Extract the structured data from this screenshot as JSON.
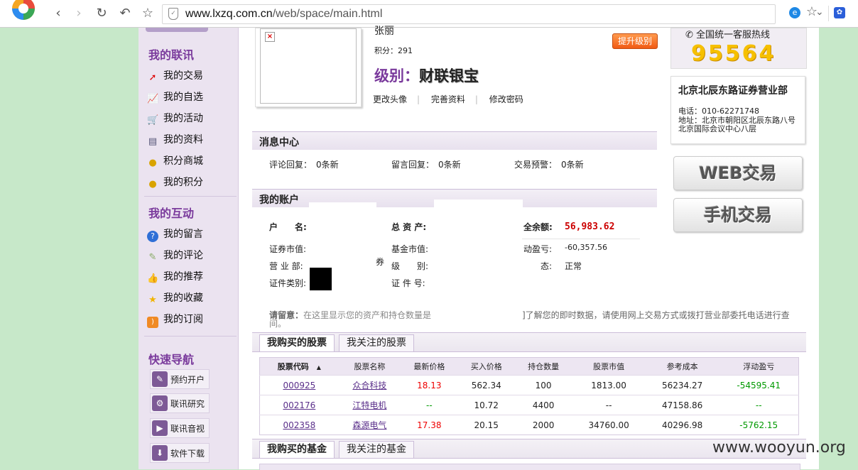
{
  "browser": {
    "url_host": "www.lxzq.com.cn",
    "url_path": "/web/space/main.html"
  },
  "sidebar": {
    "contact_title": "我的联讯",
    "contact_items": [
      {
        "label": "我的交易",
        "icon": "trend-icon"
      },
      {
        "label": "我的自选",
        "icon": "chart-icon"
      },
      {
        "label": "我的活动",
        "icon": "cart-icon"
      },
      {
        "label": "我的资料",
        "icon": "id-card-icon"
      },
      {
        "label": "积分商城",
        "icon": "coins-icon"
      },
      {
        "label": "我的积分",
        "icon": "coins-icon"
      }
    ],
    "interact_title": "我的互动",
    "interact_items": [
      {
        "label": "我的留言",
        "icon": "help-icon"
      },
      {
        "label": "我的评论",
        "icon": "edit-icon"
      },
      {
        "label": "我的推荐",
        "icon": "thumb-up-icon"
      },
      {
        "label": "我的收藏",
        "icon": "star-icon"
      },
      {
        "label": "我的订阅",
        "icon": "rss-icon"
      }
    ],
    "quick_title": "快速导航",
    "quick_items": [
      {
        "label": "预约开户",
        "icon": "edit-icon"
      },
      {
        "label": "联讯研究",
        "icon": "gear-icon"
      },
      {
        "label": "联讯音视",
        "icon": "media-icon"
      },
      {
        "label": "软件下载",
        "icon": "download-icon"
      }
    ]
  },
  "profile": {
    "name": "张丽",
    "points": "积分：291",
    "level_label": "级别：",
    "level_value": "财联银宝",
    "upgrade_button": "提升级别",
    "links": [
      "更改头像",
      "完善资料",
      "修改密码"
    ]
  },
  "messages": {
    "title": "消息中心",
    "comment_reply_label": "评论回复：",
    "comment_reply_value": "0条新",
    "message_reply_label": "留言回复：",
    "message_reply_value": "0条新",
    "trade_alert_label": "交易预警：",
    "trade_alert_value": "0条新"
  },
  "account": {
    "title": "我的账户",
    "name_label": "户　　名:",
    "total_assets_label": "总 资 产:",
    "balance_label": "全余额:",
    "balance_value": "56,983.62",
    "securities_value_label": "证券市值:",
    "fund_value_label": "基金市值:",
    "floating_label": "动盈亏:",
    "floating_value": "-60,357.56",
    "branch_label": "营 业 部:",
    "branch_partial": "券",
    "level_label": "级　　别:",
    "status_label": "态:",
    "status_value": "正常",
    "id_type_label": "证件类别:",
    "id_no_label": "证 件 号:",
    "notice_label": "请留意：",
    "notice_text_left": "在这里显示您的资产和持仓数量是",
    "notice_text_left2": "间。",
    "notice_text_right": "]了解您的即时数据，请使用网上交易方式或拨打营业部委托电话进行查"
  },
  "stocks": {
    "tab_active": "我购买的股票",
    "tab_inactive": "我关注的股票",
    "headers": [
      "股票代码",
      "股票名称",
      "最新价格",
      "买入价格",
      "持仓数量",
      "股票市值",
      "参考成本",
      "浮动盈亏"
    ],
    "sort_icon": "▲",
    "rows": [
      {
        "code": "000925",
        "name": "众合科技",
        "latest": "18.13",
        "buy": "562.34",
        "qty": "100",
        "value": "1813.00",
        "cost": "56234.27",
        "pl": "-54595.41"
      },
      {
        "code": "002176",
        "name": "江特电机",
        "latest": "--",
        "buy": "10.72",
        "qty": "4400",
        "value": "--",
        "cost": "47158.86",
        "pl": "--"
      },
      {
        "code": "002358",
        "name": "森源电气",
        "latest": "17.38",
        "buy": "20.15",
        "qty": "2000",
        "value": "34760.00",
        "cost": "40296.98",
        "pl": "-5762.15"
      }
    ]
  },
  "funds": {
    "tab_active": "我购买的基金",
    "tab_inactive": "我关注的基金"
  },
  "right": {
    "hotline_label": "全国统一客服热线",
    "hotline_number": "95564",
    "branch_title": "北京北辰东路证券营业部",
    "branch_phone": "电话：010-62271748",
    "branch_address": "地址：北京市朝阳区北辰东路八号北京国际会议中心八层",
    "web_trade": "WEB交易",
    "mobile_trade": "手机交易"
  },
  "watermark": "www.wooyun.org",
  "colors": {
    "accent": "#7a3a9c",
    "sidebar_bg": "#ebe3f0",
    "page_bg": "#c7e8c9"
  }
}
